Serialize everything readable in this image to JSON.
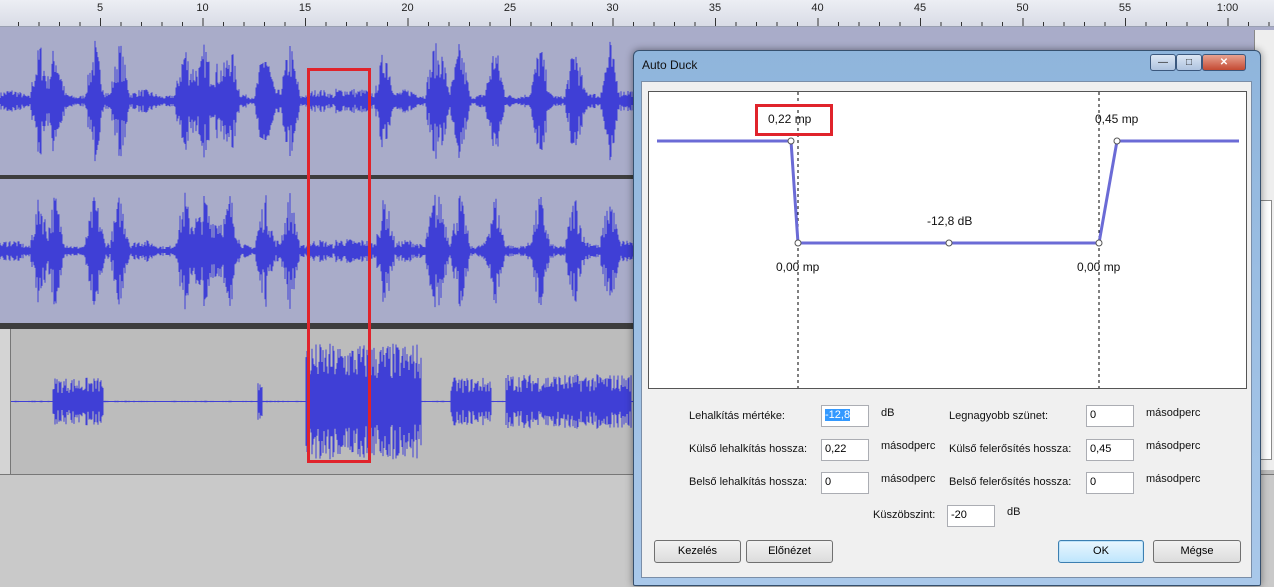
{
  "ruler": {
    "labels": [
      "5",
      "10",
      "15",
      "20",
      "25",
      "30",
      "35",
      "40",
      "45",
      "50",
      "55",
      "1:00"
    ]
  },
  "dialog": {
    "title": "Auto Duck",
    "window_buttons": {
      "minimize": "—",
      "maximize": "□",
      "close": "✕"
    },
    "graph": {
      "outer_fade_in_label": "0,22 mp",
      "outer_fade_out_label": "0,45 mp",
      "inner_fade_in_label": "0,00 mp",
      "inner_fade_out_label": "0,00 mp",
      "duck_amount_label": "-12,8 dB"
    },
    "fields": {
      "duck_amount": {
        "label": "Lehalkítás mértéke:",
        "value": "-12,8",
        "unit": "dB"
      },
      "max_pause": {
        "label": "Legnagyobb szünet:",
        "value": "0",
        "unit": "másodperc"
      },
      "outer_fade_down": {
        "label": "Külső lehalkítás hossza:",
        "value": "0,22",
        "unit": "másodperc"
      },
      "outer_fade_up": {
        "label": "Külső felerősítés hossza:",
        "value": "0,45",
        "unit": "másodperc"
      },
      "inner_fade_down": {
        "label": "Belső lehalkítás hossza:",
        "value": "0",
        "unit": "másodperc"
      },
      "inner_fade_up": {
        "label": "Belső felerősítés hossza:",
        "value": "0",
        "unit": "másodperc"
      },
      "threshold": {
        "label": "Küszöbszint:",
        "value": "-20",
        "unit": "dB"
      }
    },
    "buttons": {
      "manage": "Kezelés",
      "preview": "Előnézet",
      "ok": "OK",
      "cancel": "Mégse"
    }
  },
  "colors": {
    "waveform": "#3f3fd6",
    "highlight": "#e0232b",
    "envelope": "#6b6bd6"
  }
}
